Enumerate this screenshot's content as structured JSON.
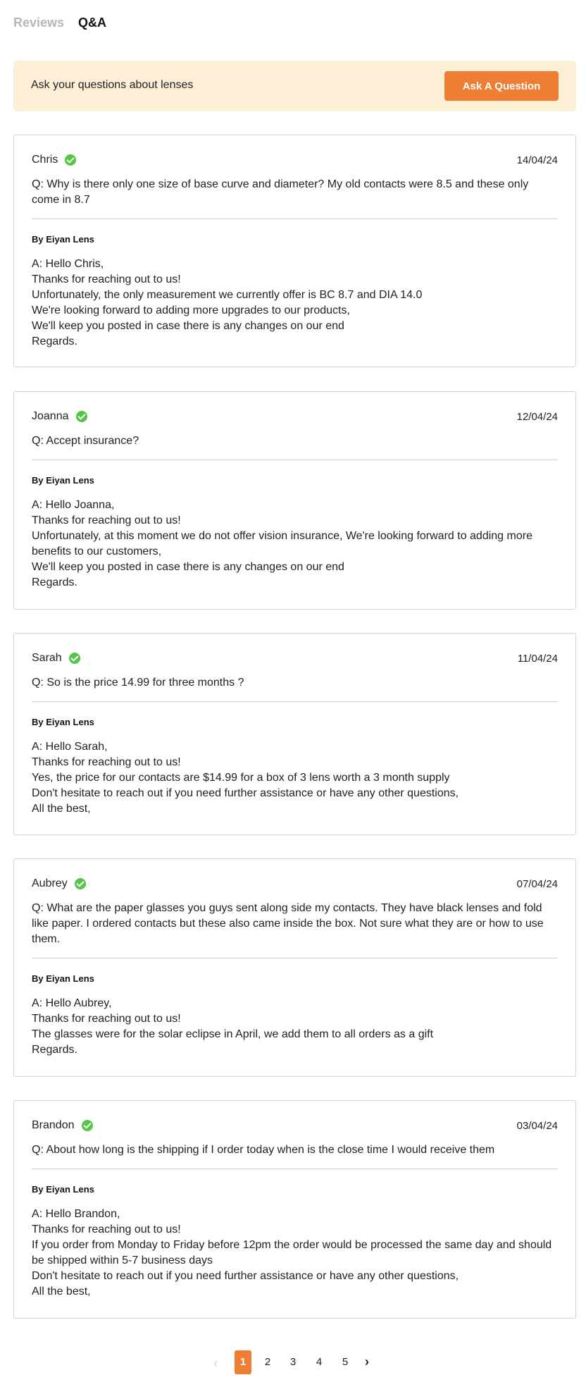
{
  "tabs": [
    {
      "label": "Reviews",
      "active": false
    },
    {
      "label": "Q&A",
      "active": true
    }
  ],
  "banner": {
    "text": "Ask your questions about lenses",
    "button_label": "Ask A Question"
  },
  "colors": {
    "accent": "#ee7e34",
    "banner_bg": "#fdefd6",
    "verified_green": "#55c447"
  },
  "questions": [
    {
      "author": "Chris",
      "date": "14/04/24",
      "question": "Q: Why is there only one size of base curve and diameter? My old contacts were 8.5 and these only come in 8.7",
      "answered_by": "By Eiyan Lens",
      "answer": [
        "A: Hello Chris,",
        "Thanks for reaching out to us!",
        "Unfortunately, the only measurement we currently offer is BC 8.7 and DIA 14.0",
        "We're looking forward to adding more upgrades to our products,",
        "We'll keep you posted in case there is any changes on our end",
        "Regards."
      ]
    },
    {
      "author": "Joanna",
      "date": "12/04/24",
      "question": "Q: Accept insurance?",
      "answered_by": "By Eiyan Lens",
      "answer": [
        "A: Hello Joanna,",
        "Thanks for reaching out to us!",
        "Unfortunately, at this moment we do not offer vision insurance, We're looking forward to adding more benefits to our customers,",
        "We'll keep you posted in case there is any changes on our end",
        "Regards."
      ]
    },
    {
      "author": "Sarah",
      "date": "11/04/24",
      "question": "Q: So is the price 14.99 for three months ?",
      "answered_by": "By Eiyan Lens",
      "answer": [
        "A: Hello Sarah,",
        "Thanks for reaching out to us!",
        "Yes, the price for our contacts are $14.99 for a box of 3 lens worth a 3 month supply",
        "Don't hesitate to reach out if you need further assistance or have any other questions,",
        "All the best,"
      ]
    },
    {
      "author": "Aubrey",
      "date": "07/04/24",
      "question": "Q: What are the paper glasses you guys sent along side my contacts. They have black lenses and fold like paper. I ordered contacts but these also came inside the box. Not sure what they are or how to use them.",
      "answered_by": "By Eiyan Lens",
      "answer": [
        "A: Hello Aubrey,",
        "Thanks for reaching out to us!",
        "The glasses were for the solar eclipse in April, we add them to all orders as a gift",
        "Regards."
      ]
    },
    {
      "author": "Brandon",
      "date": "03/04/24",
      "question": "Q: About how long is the shipping if I order today when is the close time I would receive them",
      "answered_by": "By Eiyan Lens",
      "answer": [
        "A: Hello Brandon,",
        "Thanks for reaching out to us!",
        "If you order from Monday to Friday before 12pm the order would be processed the same day and should be shipped within 5-7 business days",
        "Don't hesitate to reach out if you need further assistance or have any other questions,",
        "All the best,"
      ]
    }
  ],
  "pagination": {
    "prev_icon": "chevron-left-icon",
    "next_icon": "chevron-right-icon",
    "pages": [
      "1",
      "2",
      "3",
      "4",
      "5"
    ],
    "current": "1"
  }
}
